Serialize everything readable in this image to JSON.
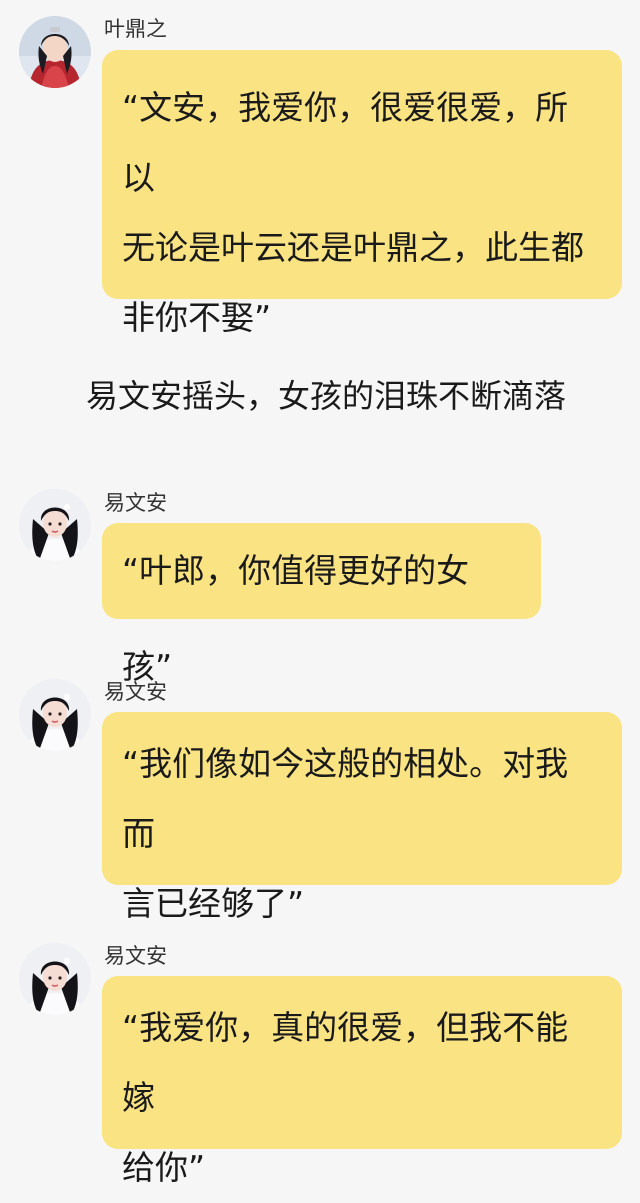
{
  "messages": [
    {
      "sender": "叶鼎之",
      "avatar_icon": "male-character-avatar-icon",
      "lines": [
        "“文安，我爱你，很爱很爱，所以",
        "无论是叶云还是叶鼎之，此生都",
        "非你不娶”"
      ]
    },
    {
      "narration": "易文安摇头，女孩的泪珠不断滴落"
    },
    {
      "sender": "易文安",
      "avatar_icon": "female-character-avatar-icon",
      "lines": [
        "“叶郎，你值得更好的女孩”"
      ]
    },
    {
      "sender": "易文安",
      "avatar_icon": "female-character-avatar-icon",
      "lines": [
        "“我们像如今这般的相处。对我而",
        "言已经够了”"
      ]
    },
    {
      "sender": "易文安",
      "avatar_icon": "female-character-avatar-icon",
      "lines": [
        "“我爱你，真的很爱，但我不能嫁",
        "给你”"
      ]
    }
  ],
  "colors": {
    "background": "#f6f6f6",
    "bubble": "#f9e383",
    "text": "#1a1a1a"
  }
}
